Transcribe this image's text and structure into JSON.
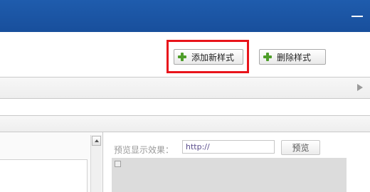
{
  "toolbar": {
    "add_style_label": "添加新样式",
    "delete_style_label": "删除样式",
    "highlight_color": "#e8141b"
  },
  "preview": {
    "label": "预览显示效果：",
    "url_value": "http://",
    "button_label": "预览"
  },
  "icons": {
    "add": "plus-icon",
    "delete": "plus-icon",
    "minimize": "minimize-icon",
    "expand": "triangle-right-icon",
    "scroll_up": "chevron-up-icon",
    "broken_image": "broken-image-icon"
  },
  "colors": {
    "titlebar": "#1f5cad",
    "plus_icon": "#4e9e2a"
  }
}
